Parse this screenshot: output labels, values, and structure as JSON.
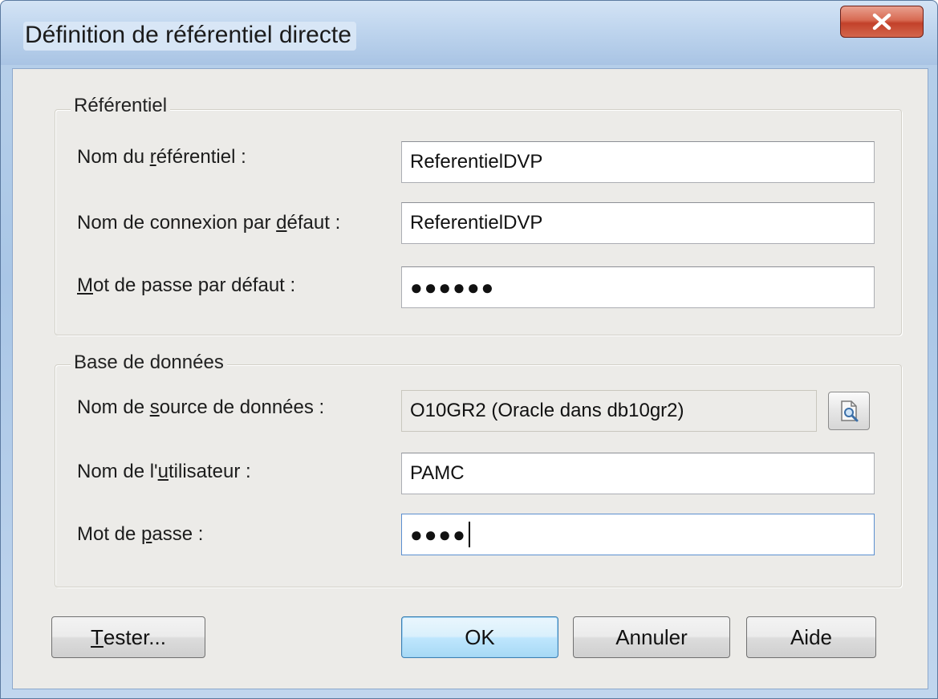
{
  "window": {
    "title": "Définition de référentiel directe"
  },
  "groups": {
    "referentiel": {
      "title": "Référentiel",
      "fields": [
        {
          "label_pre": "Nom du ",
          "label_ul": "r",
          "label_post": "éférentiel :",
          "value": "ReferentielDVP"
        },
        {
          "label_pre": "Nom de connexion par ",
          "label_ul": "d",
          "label_post": "éfaut :",
          "value": "ReferentielDVP"
        },
        {
          "label_pre": "",
          "label_ul": "M",
          "label_post": "ot de passe par défaut :",
          "value": "●●●●●●"
        }
      ]
    },
    "base": {
      "title": "Base de données",
      "fields": [
        {
          "label_pre": "Nom de ",
          "label_ul": "s",
          "label_post": "ource de données  :",
          "value": "O10GR2 (Oracle dans db10gr2)"
        },
        {
          "label_pre": "Nom de l'",
          "label_ul": "u",
          "label_post": "tilisateur :",
          "value": "PAMC"
        },
        {
          "label_pre": "Mot de ",
          "label_ul": "p",
          "label_post": "asse :",
          "value": "●●●●"
        }
      ]
    }
  },
  "buttons": {
    "test": {
      "ul": "T",
      "rest": "ester..."
    },
    "ok": "OK",
    "cancel": "Annuler",
    "help": "Aide"
  },
  "icons": {
    "close": "close-icon",
    "browse": "browse-datasource-icon"
  }
}
